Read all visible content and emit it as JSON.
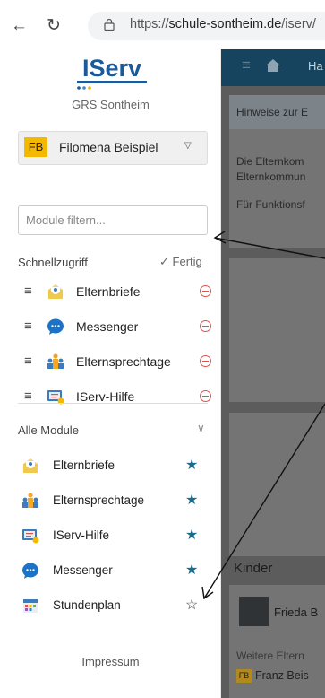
{
  "browser": {
    "back_icon": "arrow-left-icon",
    "reload_icon": "reload-icon",
    "url_prefix": "https://",
    "url_domain": "schule-sontheim.de",
    "url_path": "/iserv/"
  },
  "sidebar": {
    "logo_text": "IServ",
    "school_name": "GRS Sontheim",
    "user_initials": "FB",
    "user_name": "Filomena Beispiel",
    "filter_placeholder": "Module filtern...",
    "quick_title": "Schnellzugriff",
    "done_label": "Fertig",
    "quick_items": [
      {
        "label": "Elternbriefe",
        "icon": "letter-icon"
      },
      {
        "label": "Messenger",
        "icon": "chat-bubble-icon"
      },
      {
        "label": "Elternsprechtage",
        "icon": "people-icon"
      },
      {
        "label": "IServ-Hilfe",
        "icon": "help-screen-icon"
      }
    ],
    "all_title": "Alle Module",
    "all_items": [
      {
        "label": "Elternbriefe",
        "icon": "letter-icon",
        "favorite": true
      },
      {
        "label": "Elternsprechtage",
        "icon": "people-icon",
        "favorite": true
      },
      {
        "label": "IServ-Hilfe",
        "icon": "help-screen-icon",
        "favorite": true
      },
      {
        "label": "Messenger",
        "icon": "chat-bubble-icon",
        "favorite": true
      },
      {
        "label": "Stundenplan",
        "icon": "calendar-icon",
        "favorite": false
      }
    ],
    "impressum": "Impressum"
  },
  "main": {
    "breadcrumb": "Ha",
    "notice_title": "Hinweise zur E",
    "notice_line1": "Die Elternkom",
    "notice_line2": "Elternkommun",
    "notice_line3": "Für Funktionsf",
    "children_title": "Kinder",
    "child_name": "Frieda B",
    "more_parents": "Weitere Eltern",
    "parent_initials": "FB",
    "parent_name": "Franz Beis"
  },
  "colors": {
    "accent": "#1c6a8c",
    "nav": "#16445e",
    "badge": "#f5b800",
    "remove": "#d9534f"
  }
}
